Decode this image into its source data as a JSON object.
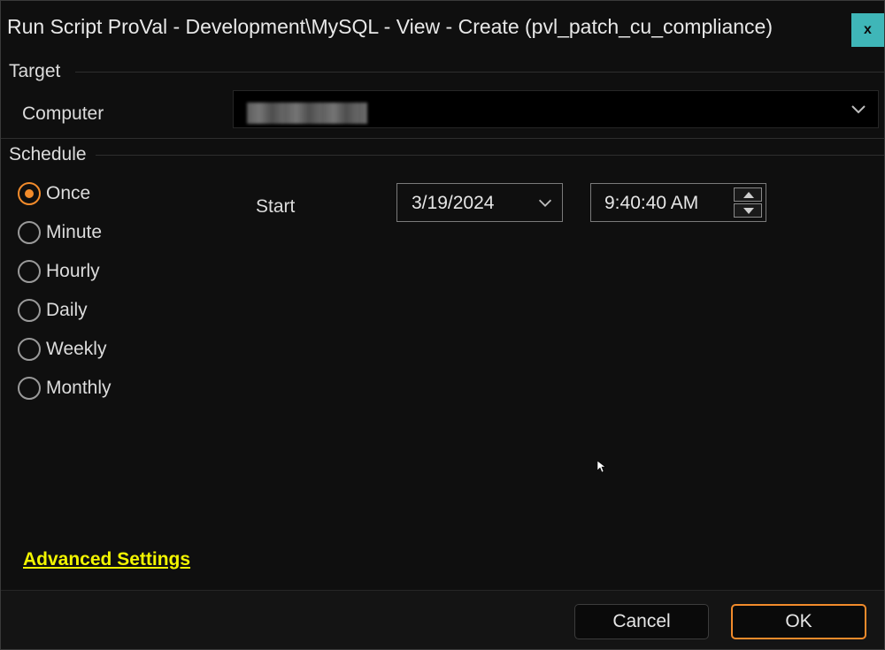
{
  "window": {
    "title": "Run Script ProVal - Development\\MySQL - View - Create (pvl_patch_cu_compliance)",
    "close_label": "x"
  },
  "target": {
    "group_label": "Target",
    "computer_label": "Computer"
  },
  "schedule": {
    "group_label": "Schedule",
    "options": [
      {
        "label": "Once",
        "checked": true
      },
      {
        "label": "Minute",
        "checked": false
      },
      {
        "label": "Hourly",
        "checked": false
      },
      {
        "label": "Daily",
        "checked": false
      },
      {
        "label": "Weekly",
        "checked": false
      },
      {
        "label": "Monthly",
        "checked": false
      }
    ],
    "start_label": "Start",
    "start_date": "3/19/2024",
    "start_time": "9:40:40 AM"
  },
  "advanced_settings_label": "Advanced Settings",
  "footer": {
    "cancel_label": "Cancel",
    "ok_label": "OK"
  },
  "colors": {
    "background": "#0f0f0f",
    "accent_orange": "#f28b2b",
    "close_button": "#3fb6b8",
    "link_yellow": "#f2f500"
  },
  "icons": {
    "close": "close-icon",
    "combo_dropdown": "chevron-down-icon",
    "date_dropdown": "chevron-down-icon",
    "spin_up": "caret-up-icon",
    "spin_down": "caret-down-icon"
  }
}
